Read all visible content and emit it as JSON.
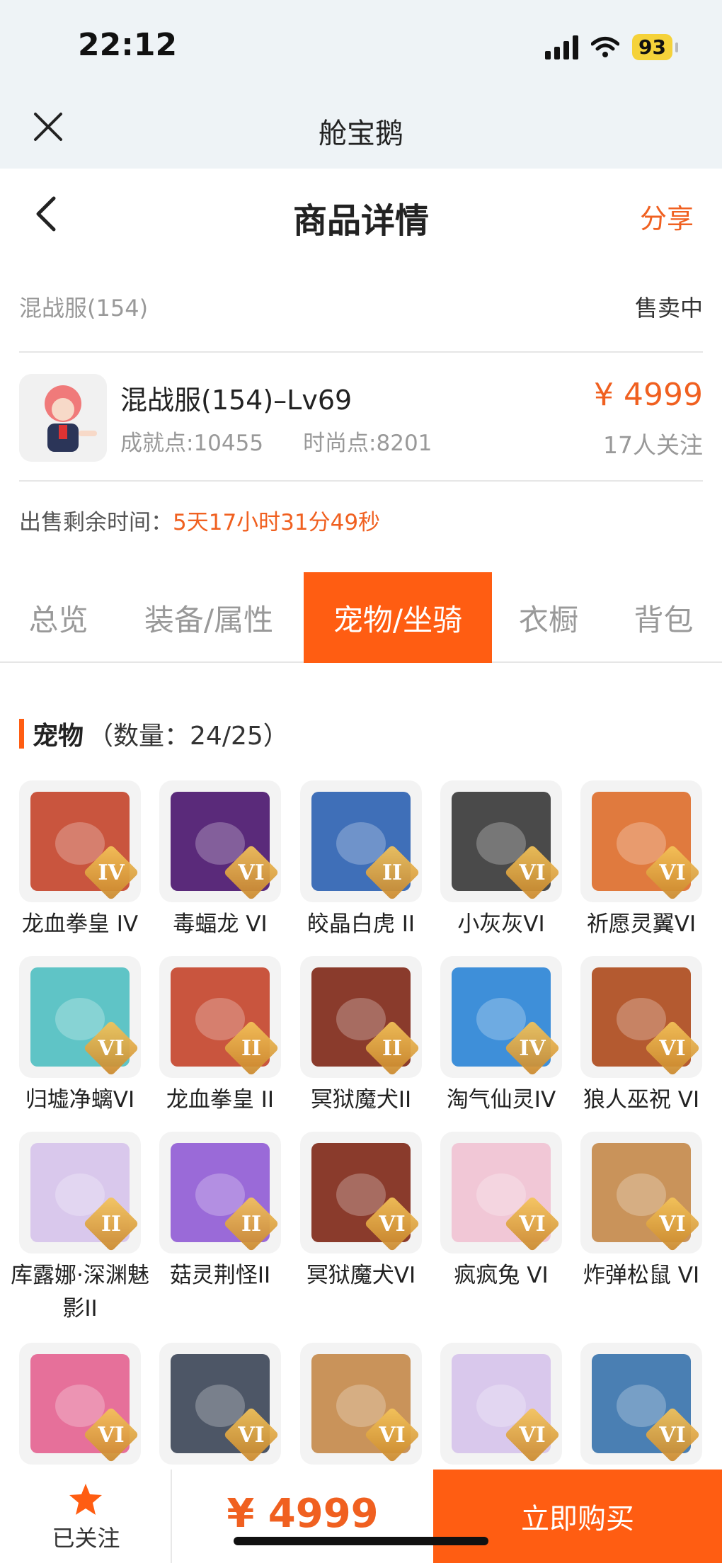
{
  "status_bar": {
    "time": "22:12",
    "battery": "93"
  },
  "mini_program": {
    "title": "舱宝鹅"
  },
  "nav": {
    "title": "商品详情",
    "share_label": "分享"
  },
  "server": {
    "name": "混战服(154)",
    "status": "售卖中"
  },
  "item": {
    "title": "混战服(154)–Lv69",
    "achievement": "成就点:10455",
    "fashion": "时尚点:8201",
    "price": "¥ 4999",
    "followers": "17人关注"
  },
  "remaining": {
    "label": "出售剩余时间：",
    "value": "5天17小时31分49秒"
  },
  "tabs": [
    "总览",
    "装备/属性",
    "宠物/坐骑",
    "衣橱",
    "背包"
  ],
  "active_tab": "宠物/坐骑",
  "pets_section": {
    "title": "宠物",
    "count": "（数量：24/25）"
  },
  "pets": [
    {
      "name": "龙血拳皇 IV",
      "rank": "IV",
      "color": "#c9553e"
    },
    {
      "name": "毒蝠龙 VI",
      "rank": "VI",
      "color": "#5a2a7a"
    },
    {
      "name": "皎晶白虎 II",
      "rank": "II",
      "color": "#3f6fb8"
    },
    {
      "name": "小灰灰VI",
      "rank": "VI",
      "color": "#4a4a4a"
    },
    {
      "name": "祈愿灵翼VI",
      "rank": "VI",
      "color": "#e07a3e"
    },
    {
      "name": "归墟净螭VI",
      "rank": "VI",
      "color": "#5fc4c6"
    },
    {
      "name": "龙血拳皇 II",
      "rank": "II",
      "color": "#c9553e"
    },
    {
      "name": "冥狱魔犬II",
      "rank": "II",
      "color": "#8a3b2c"
    },
    {
      "name": "淘气仙灵IV",
      "rank": "IV",
      "color": "#3e8fd9"
    },
    {
      "name": "狼人巫祝 VI",
      "rank": "VI",
      "color": "#b45a30"
    },
    {
      "name": "库露娜·深渊魅影II",
      "rank": "II",
      "color": "#d9c8ec"
    },
    {
      "name": "菇灵荆怪II",
      "rank": "II",
      "color": "#9a6ad8"
    },
    {
      "name": "冥狱魔犬VI",
      "rank": "VI",
      "color": "#8a3b2c"
    },
    {
      "name": "疯疯兔 VI",
      "rank": "VI",
      "color": "#f1c7d6"
    },
    {
      "name": "炸弹松鼠 VI",
      "rank": "VI",
      "color": "#c9935a"
    },
    {
      "name": "",
      "rank": "VI",
      "color": "#e6709a"
    },
    {
      "name": "",
      "rank": "VI",
      "color": "#4d5666"
    },
    {
      "name": "",
      "rank": "VI",
      "color": "#c9935a"
    },
    {
      "name": "",
      "rank": "VI",
      "color": "#d9c8ec"
    },
    {
      "name": "",
      "rank": "VI",
      "color": "#4a7fb3"
    }
  ],
  "bottom": {
    "follow_label": "已关注",
    "price": "¥ 4999",
    "buy_label": "立即购买"
  },
  "colors": {
    "accent": "#ff5d12",
    "price": "#f06020"
  }
}
